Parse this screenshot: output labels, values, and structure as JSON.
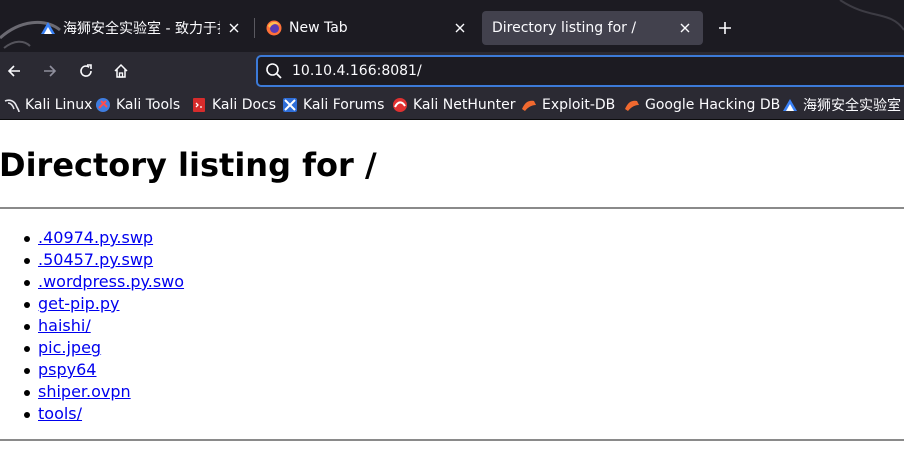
{
  "browser": {
    "tabs": [
      {
        "title": "海狮安全实验室 - 致力于打",
        "favicon": "shark-logo-icon",
        "active": false
      },
      {
        "title": "New Tab",
        "favicon": "firefox-icon",
        "active": false
      },
      {
        "title": "Directory listing for /",
        "favicon": "",
        "active": true
      }
    ],
    "new_tab_label": "+",
    "url": "10.10.4.166:8081/",
    "accent": "#3c7ad8"
  },
  "bookmarks": [
    {
      "label": "Kali Linux",
      "icon": "kali-dragon-icon"
    },
    {
      "label": "Kali Tools",
      "icon": "kali-tools-icon"
    },
    {
      "label": "Kali Docs",
      "icon": "kali-docs-icon"
    },
    {
      "label": "Kali Forums",
      "icon": "kali-forums-icon"
    },
    {
      "label": "Kali NetHunter",
      "icon": "nethunter-icon"
    },
    {
      "label": "Exploit-DB",
      "icon": "exploit-db-icon"
    },
    {
      "label": "Google Hacking DB",
      "icon": "ghdb-icon"
    },
    {
      "label": "海狮安全实验室",
      "icon": "shark-logo-icon"
    }
  ],
  "page": {
    "heading": "Directory listing for /",
    "files": [
      ".40974.py.swp",
      ".50457.py.swp",
      ".wordpress.py.swo",
      "get-pip.py",
      "haishi/",
      "pic.jpeg",
      "pspy64",
      "shiper.ovpn",
      "tools/"
    ],
    "link_color": "#0000ee"
  }
}
